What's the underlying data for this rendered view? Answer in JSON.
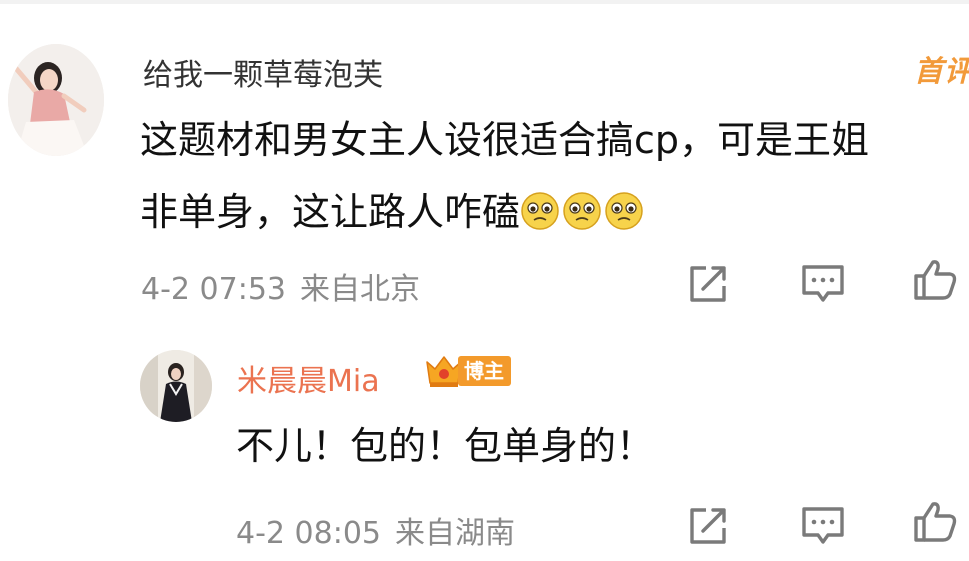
{
  "comment": {
    "username": "给我一颗草莓泡芙",
    "top_badge": "首评",
    "text_line1": "这题材和男女主人设很适合搞cp，可是王姐",
    "text_line2": "非单身，这让路人咋磕",
    "emoji_name": "pleading-face-icon",
    "time": "4-2 07:53",
    "location": "来自北京"
  },
  "reply": {
    "username": "米晨晨Mia",
    "badge": "博主",
    "text": "不儿！包的！包单身的！",
    "time": "4-2 08:05",
    "location": "来自湖南"
  },
  "colors": {
    "username_gray": "#333333",
    "reply_name_orange": "#eb7350",
    "badge_orange": "#f39a2b",
    "meta_gray": "#8a8a8a",
    "icon_gray": "#7a7a7a"
  }
}
